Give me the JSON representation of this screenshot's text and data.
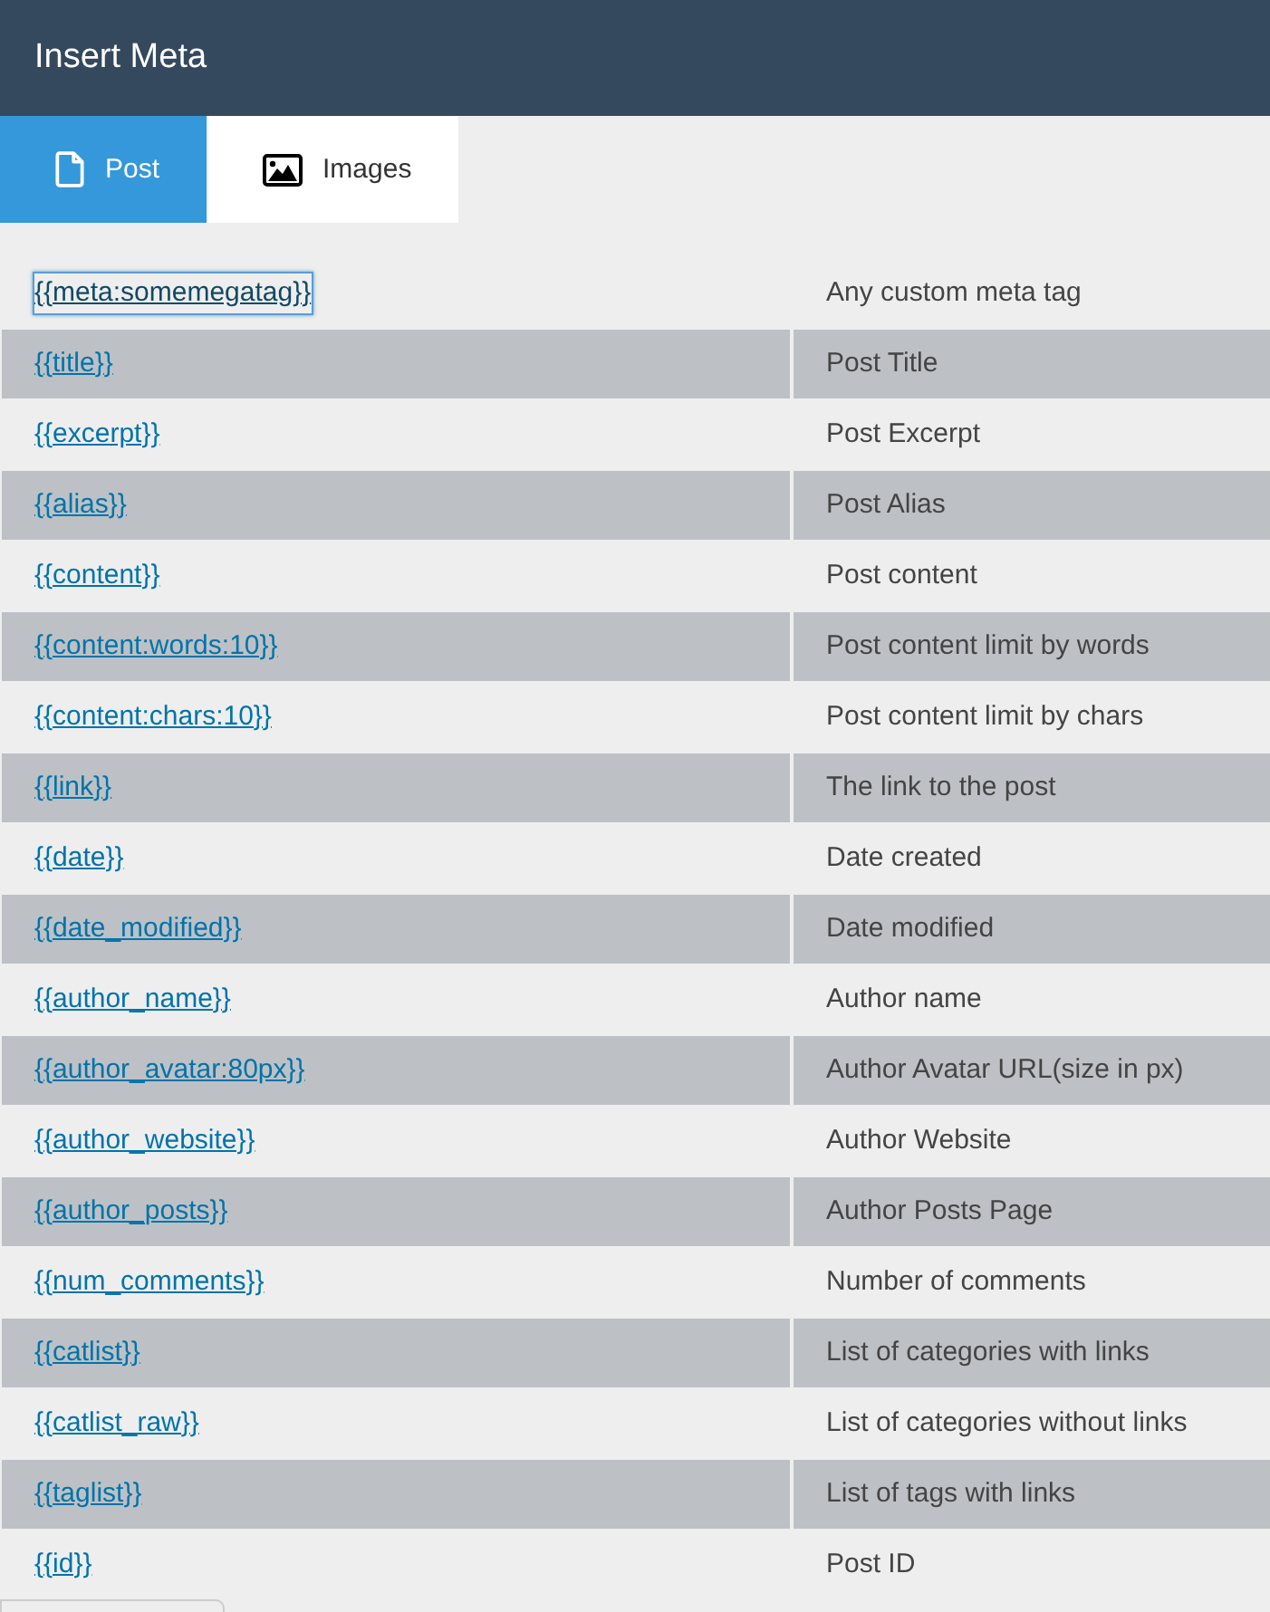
{
  "window": {
    "title": "Insert Meta"
  },
  "tabs": [
    {
      "label": "Post",
      "selected": true
    },
    {
      "label": "Images",
      "selected": false
    }
  ],
  "table": {
    "rows": [
      {
        "tag": "{{meta:somemegatag}}",
        "description": "Any custom meta tag",
        "focused": true
      },
      {
        "tag": "{{title}}",
        "description": "Post Title",
        "focused": false
      },
      {
        "tag": "{{excerpt}}",
        "description": "Post Excerpt",
        "focused": false
      },
      {
        "tag": "{{alias}}",
        "description": "Post Alias",
        "focused": false
      },
      {
        "tag": "{{content}}",
        "description": "Post content",
        "focused": false
      },
      {
        "tag": "{{content:words:10}}",
        "description": "Post content limit by words",
        "focused": false
      },
      {
        "tag": "{{content:chars:10}}",
        "description": "Post content limit by chars",
        "focused": false
      },
      {
        "tag": "{{link}}",
        "description": "The link to the post",
        "focused": false
      },
      {
        "tag": "{{date}}",
        "description": "Date created",
        "focused": false
      },
      {
        "tag": "{{date_modified}}",
        "description": "Date modified",
        "focused": false
      },
      {
        "tag": "{{author_name}}",
        "description": "Author name",
        "focused": false
      },
      {
        "tag": "{{author_avatar:80px}}",
        "description": "Author Avatar URL(size in px)",
        "focused": false
      },
      {
        "tag": "{{author_website}}",
        "description": "Author Website",
        "focused": false
      },
      {
        "tag": "{{author_posts}}",
        "description": "Author Posts Page",
        "focused": false
      },
      {
        "tag": "{{num_comments}}",
        "description": "Number of comments",
        "focused": false
      },
      {
        "tag": "{{catlist}}",
        "description": "List of categories with links",
        "focused": false
      },
      {
        "tag": "{{catlist_raw}}",
        "description": "List of categories without links",
        "focused": false
      },
      {
        "tag": "{{taglist}}",
        "description": "List of tags with links",
        "focused": false
      },
      {
        "tag": "{{id}}",
        "description": "Post ID",
        "focused": false
      }
    ]
  }
}
